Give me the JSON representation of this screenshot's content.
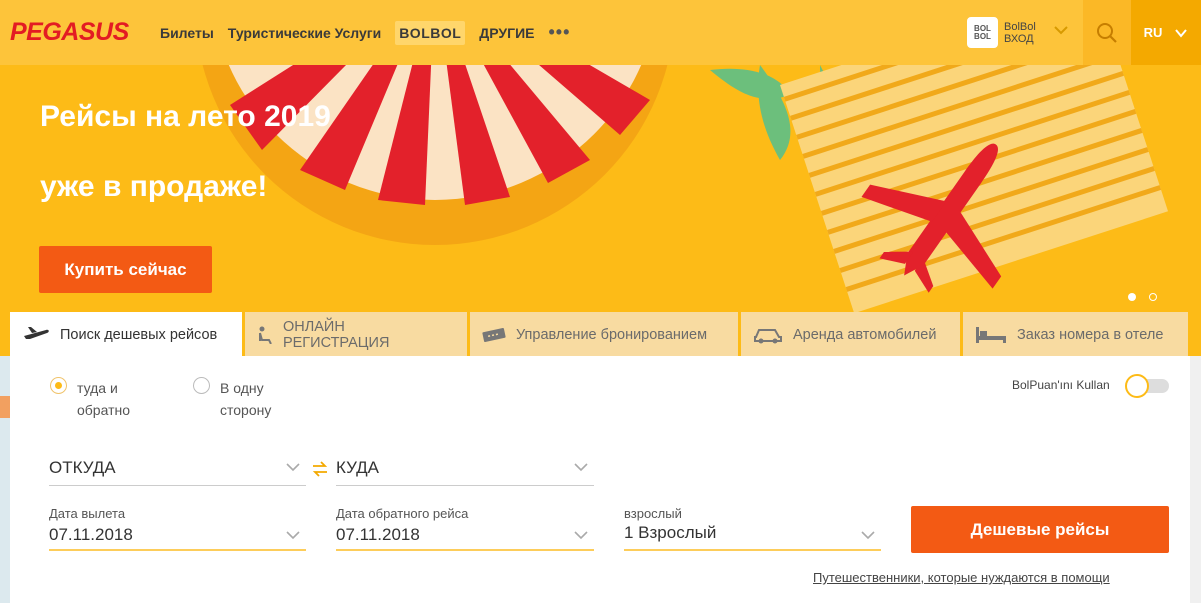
{
  "header": {
    "logo": "PEGASUS",
    "nav": [
      "Билеты",
      "Туристические Услуги",
      "BOLBOL",
      "ДРУГИЕ"
    ],
    "more_icon": "more-dots-icon",
    "bolbol_logo": "BOL BOL",
    "bolbol_name": "BolBol",
    "bolbol_login": "ВХОД",
    "language": "RU"
  },
  "banner": {
    "title_line1": "Рейсы на лето 2019",
    "title_line2": "уже в продаже!",
    "cta": "Купить сейчас",
    "slides": 2,
    "active_slide": 1
  },
  "tabs": [
    {
      "label": "Поиск дешевых рейсов",
      "icon": "plane-icon",
      "active": true
    },
    {
      "label": "ОНЛАЙН РЕГИСТРАЦИЯ",
      "icon": "seat-icon",
      "active": false
    },
    {
      "label": "Управление бронированием",
      "icon": "ticket-icon",
      "active": false
    },
    {
      "label": "Аренда автомобилей",
      "icon": "car-icon",
      "active": false
    },
    {
      "label": "Заказ номера в отеле",
      "icon": "bed-icon",
      "active": false
    }
  ],
  "search": {
    "trip_types": [
      {
        "line1": "туда и",
        "line2": "обратно",
        "selected": true
      },
      {
        "line1": "В одну",
        "line2": "сторону",
        "selected": false
      }
    ],
    "bolpuan_label": "BolPuan'ını Kullan",
    "bolpuan_enabled": false,
    "from_placeholder": "ОТКУДА",
    "to_placeholder": "КУДА",
    "depart_label": "Дата вылета",
    "depart_value": "07.11.2018",
    "return_label": "Дата обратного рейса",
    "return_value": "07.11.2018",
    "passenger_label": "взрослый",
    "passenger_value": "1 Взрослый",
    "submit": "Дешевые рейсы",
    "help_link": "Путешественники, которые нуждаются в помощи"
  },
  "colors": {
    "brand_yellow": "#fdbb17",
    "header_yellow": "#fdc43a",
    "cta_orange": "#f35a14",
    "logo_red": "#e31b23"
  }
}
